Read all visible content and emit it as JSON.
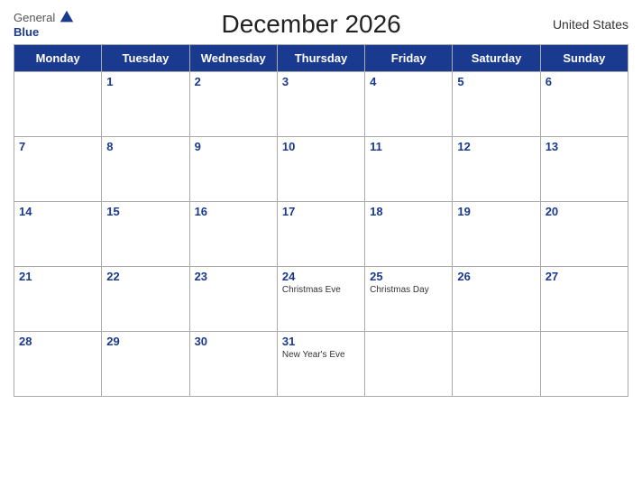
{
  "header": {
    "logo_general": "General",
    "logo_blue": "Blue",
    "title": "December 2026",
    "country": "United States"
  },
  "days_of_week": [
    "Monday",
    "Tuesday",
    "Wednesday",
    "Thursday",
    "Friday",
    "Saturday",
    "Sunday"
  ],
  "weeks": [
    [
      {
        "day": "",
        "holiday": ""
      },
      {
        "day": "1",
        "holiday": ""
      },
      {
        "day": "2",
        "holiday": ""
      },
      {
        "day": "3",
        "holiday": ""
      },
      {
        "day": "4",
        "holiday": ""
      },
      {
        "day": "5",
        "holiday": ""
      },
      {
        "day": "6",
        "holiday": ""
      }
    ],
    [
      {
        "day": "7",
        "holiday": ""
      },
      {
        "day": "8",
        "holiday": ""
      },
      {
        "day": "9",
        "holiday": ""
      },
      {
        "day": "10",
        "holiday": ""
      },
      {
        "day": "11",
        "holiday": ""
      },
      {
        "day": "12",
        "holiday": ""
      },
      {
        "day": "13",
        "holiday": ""
      }
    ],
    [
      {
        "day": "14",
        "holiday": ""
      },
      {
        "day": "15",
        "holiday": ""
      },
      {
        "day": "16",
        "holiday": ""
      },
      {
        "day": "17",
        "holiday": ""
      },
      {
        "day": "18",
        "holiday": ""
      },
      {
        "day": "19",
        "holiday": ""
      },
      {
        "day": "20",
        "holiday": ""
      }
    ],
    [
      {
        "day": "21",
        "holiday": ""
      },
      {
        "day": "22",
        "holiday": ""
      },
      {
        "day": "23",
        "holiday": ""
      },
      {
        "day": "24",
        "holiday": "Christmas Eve"
      },
      {
        "day": "25",
        "holiday": "Christmas Day"
      },
      {
        "day": "26",
        "holiday": ""
      },
      {
        "day": "27",
        "holiday": ""
      }
    ],
    [
      {
        "day": "28",
        "holiday": ""
      },
      {
        "day": "29",
        "holiday": ""
      },
      {
        "day": "30",
        "holiday": ""
      },
      {
        "day": "31",
        "holiday": "New Year's Eve"
      },
      {
        "day": "",
        "holiday": ""
      },
      {
        "day": "",
        "holiday": ""
      },
      {
        "day": "",
        "holiday": ""
      }
    ]
  ]
}
